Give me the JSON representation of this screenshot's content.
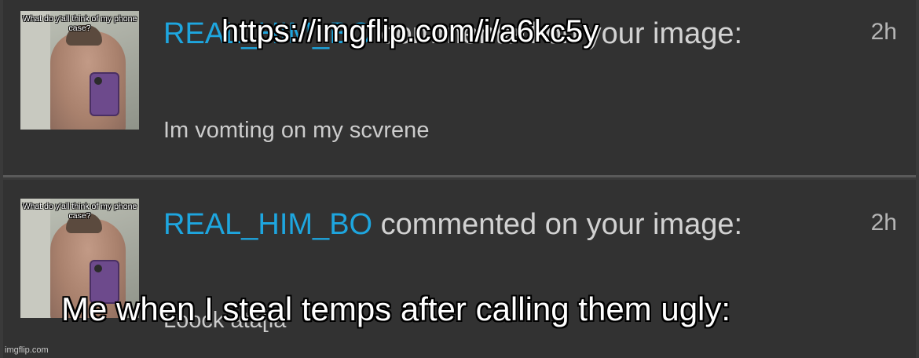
{
  "notifications": [
    {
      "thumb_caption": "What do y'all think of my phone case?",
      "username": "REAL_HIM_BO",
      "action": " commented on your image:",
      "time": "2h",
      "comment": "Im vomting on my scvrene"
    },
    {
      "thumb_caption": "What do y'all think of my phone case?",
      "username": "REAL_HIM_BO",
      "action": " commented on your image:",
      "time": "2h",
      "comment": "Loock ata[ia"
    }
  ],
  "overlay": {
    "top_text": "https://imgflip.com/i/a6kc5y",
    "bottom_text": "Me when I steal temps after calling them ugly:"
  },
  "watermark": "imgflip.com",
  "colors": {
    "background": "#323232",
    "username": "#1ea6df",
    "text": "#d2d2d2",
    "divider": "#5a5a5a"
  }
}
